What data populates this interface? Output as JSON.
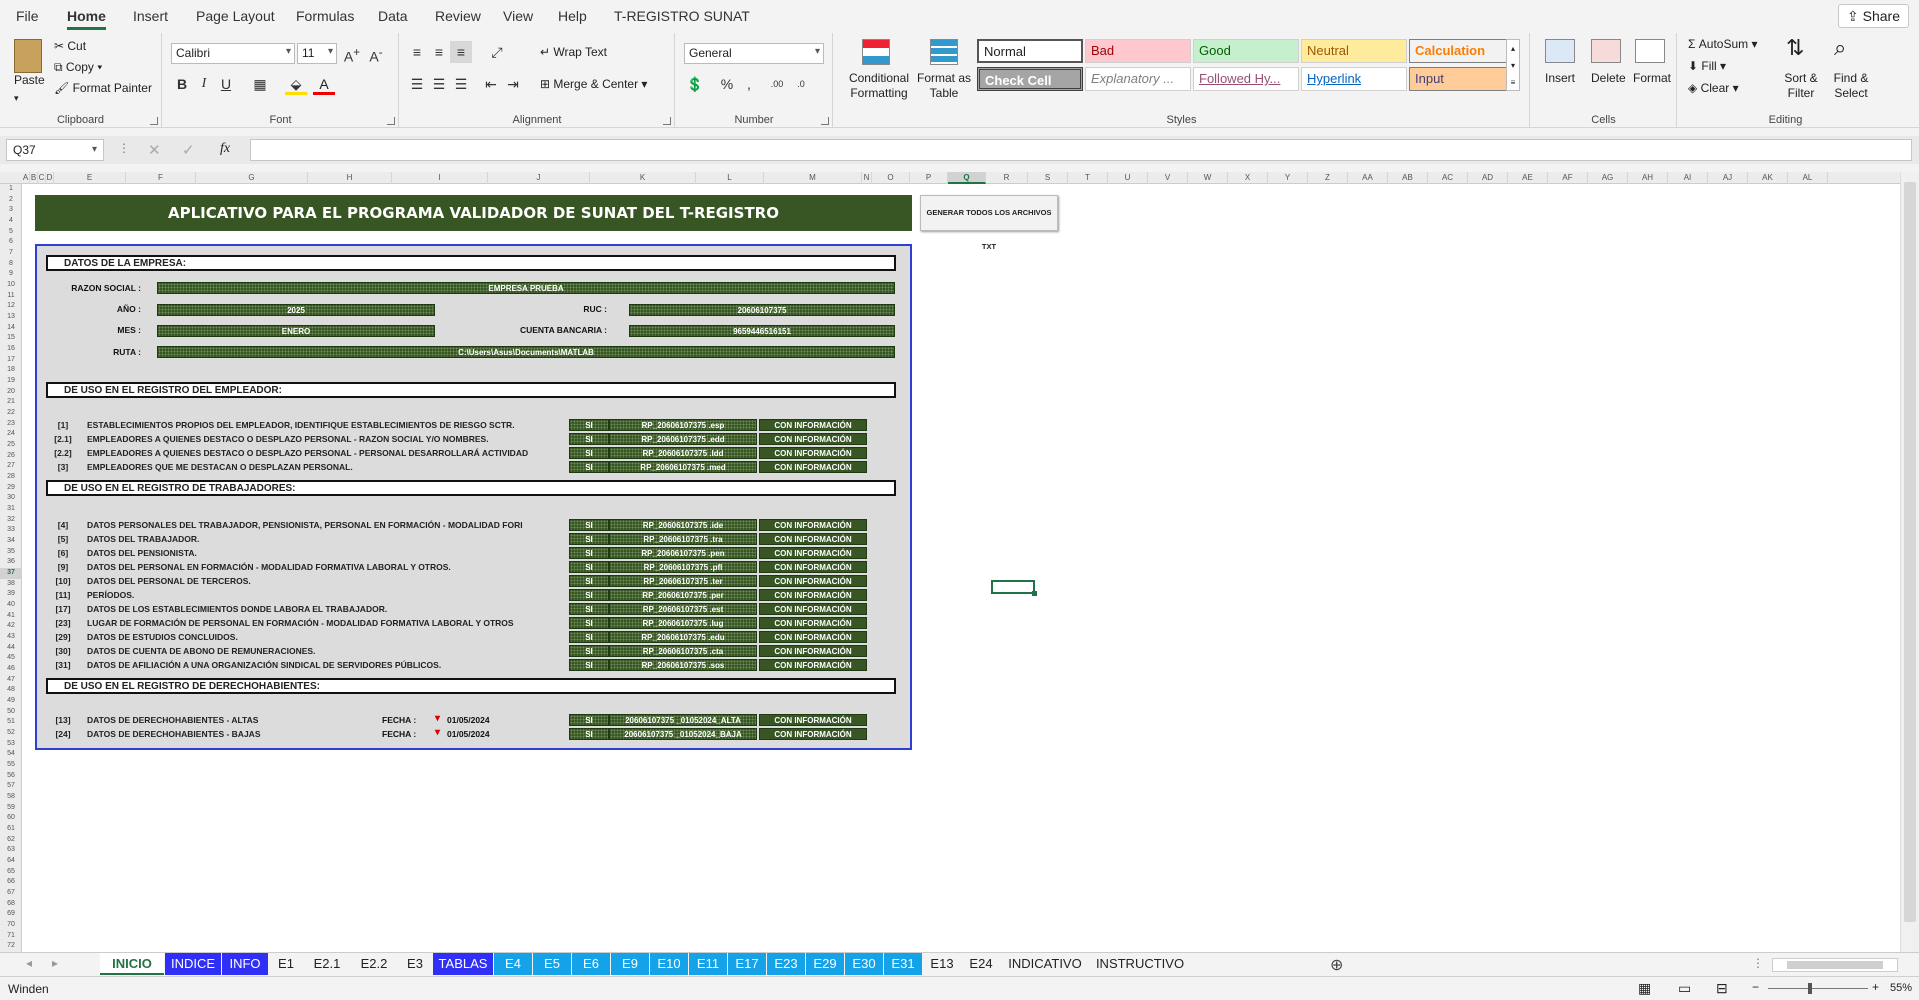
{
  "ribbon_tabs": [
    "File",
    "Home",
    "Insert",
    "Page Layout",
    "Formulas",
    "Data",
    "Review",
    "View",
    "Help",
    "T-REGISTRO SUNAT"
  ],
  "share_label": "Share",
  "clipboard": {
    "paste": "Paste",
    "cut": "Cut",
    "copy": "Copy",
    "format_painter": "Format Painter",
    "label": "Clipboard"
  },
  "font": {
    "name": "Calibri",
    "size": "11",
    "label": "Font"
  },
  "alignment": {
    "wrap": "Wrap Text",
    "merge": "Merge & Center",
    "label": "Alignment"
  },
  "number": {
    "format": "General",
    "label": "Number"
  },
  "styles": {
    "conditional": "Conditional Formatting",
    "format_table": "Format as Table",
    "cells": [
      "Normal",
      "Bad",
      "Good",
      "Neutral",
      "Calculation",
      "Check Cell",
      "Explanatory ...",
      "Followed Hy...",
      "Hyperlink",
      "Input"
    ],
    "label": "Styles"
  },
  "cells_group": {
    "insert": "Insert",
    "delete": "Delete",
    "format": "Format",
    "label": "Cells"
  },
  "editing": {
    "autosum": "AutoSum",
    "fill": "Fill",
    "clear": "Clear",
    "sort": "Sort & Filter",
    "find": "Find & Select",
    "label": "Editing"
  },
  "namebox": "Q37",
  "columns": [
    "A",
    "B",
    "C",
    "D",
    "E",
    "F",
    "G",
    "H",
    "I",
    "J",
    "K",
    "L",
    "M",
    "N",
    "O",
    "P",
    "Q",
    "R",
    "S",
    "T",
    "U",
    "V",
    "W",
    "X",
    "Y",
    "Z",
    "AA",
    "AB",
    "AC",
    "AD",
    "AE",
    "AF",
    "AG",
    "AH",
    "AI",
    "AJ",
    "AK",
    "AL"
  ],
  "rows": [
    "1",
    "2",
    "3",
    "4",
    "5",
    "6",
    "7",
    "8",
    "9",
    "10",
    "11",
    "12",
    "13",
    "14",
    "15",
    "16",
    "17",
    "18",
    "19",
    "20",
    "21",
    "22",
    "23",
    "24",
    "25",
    "26",
    "27",
    "28",
    "29",
    "30",
    "31",
    "32",
    "33",
    "34",
    "35",
    "36",
    "37",
    "38",
    "39",
    "40",
    "41",
    "42",
    "43",
    "44",
    "45",
    "46",
    "47",
    "48",
    "49",
    "50",
    "51",
    "52",
    "53",
    "54",
    "55",
    "56",
    "57",
    "58",
    "59",
    "60",
    "61",
    "62",
    "63",
    "64",
    "65",
    "66",
    "67",
    "68",
    "69",
    "70",
    "71",
    "72"
  ],
  "app": {
    "title": "APLICATIVO PARA EL PROGRAMA VALIDADOR DE SUNAT DEL T-REGISTRO",
    "generate_btn": "GENERAR TODOS LOS ARCHIVOS TXT",
    "empresa_head": "DATOS DE LA EMPRESA:",
    "razon_label": "RAZON SOCIAL :",
    "razon": "EMPRESA PRUEBA",
    "anio_label": "AÑO :",
    "anio": "2025",
    "ruc_label": "RUC :",
    "ruc": "20606107375",
    "mes_label": "MES :",
    "mes": "ENERO",
    "cuenta_label": "CUENTA BANCARIA :",
    "cuenta": "9659446516151",
    "ruta_label": "RUTA :",
    "ruta": "C:\\Users\\Asus\\Documents\\MATLAB",
    "empleador_head": "DE USO EN EL REGISTRO DEL EMPLEADOR:",
    "empleador_rows": [
      {
        "num": "[1]",
        "desc": "ESTABLECIMIENTOS PROPIOS DEL EMPLEADOR, IDENTIFIQUE ESTABLECIMIENTOS DE RIESGO SCTR.",
        "si": "SI",
        "file": "RP_20606107375 .esp",
        "info": "CON INFORMACIÓN"
      },
      {
        "num": "[2.1]",
        "desc": "EMPLEADORES A QUIENES DESTACO O DESPLAZO PERSONAL - RAZON SOCIAL Y/O NOMBRES.",
        "si": "SI",
        "file": "RP_20606107375 .edd",
        "info": "CON INFORMACIÓN"
      },
      {
        "num": "[2.2]",
        "desc": "EMPLEADORES A QUIENES DESTACO O DESPLAZO PERSONAL - PERSONAL DESARROLLARÁ ACTIVIDAD",
        "si": "SI",
        "file": "RP_20606107375 .ldd",
        "info": "CON INFORMACIÓN"
      },
      {
        "num": "[3]",
        "desc": "EMPLEADORES QUE ME DESTACAN O DESPLAZAN PERSONAL.",
        "si": "SI",
        "file": "RP_20606107375 .med",
        "info": "CON INFORMACIÓN"
      }
    ],
    "trabajadores_head": "DE USO EN EL REGISTRO DE TRABAJADORES:",
    "trabajadores_rows": [
      {
        "num": "[4]",
        "desc": "DATOS PERSONALES DEL TRABAJADOR, PENSIONISTA, PERSONAL EN FORMACIÓN - MODALIDAD FORI",
        "si": "SI",
        "file": "RP_20606107375 .ide",
        "info": "CON INFORMACIÓN"
      },
      {
        "num": "[5]",
        "desc": "DATOS DEL TRABAJADOR.",
        "si": "SI",
        "file": "RP_20606107375 .tra",
        "info": "CON INFORMACIÓN"
      },
      {
        "num": "[6]",
        "desc": "DATOS DEL PENSIONISTA.",
        "si": "SI",
        "file": "RP_20606107375 .pen",
        "info": "CON INFORMACIÓN"
      },
      {
        "num": "[9]",
        "desc": "DATOS DEL PERSONAL EN FORMACIÓN - MODALIDAD FORMATIVA LABORAL Y OTROS.",
        "si": "SI",
        "file": "RP_20606107375 .pfl",
        "info": "CON INFORMACIÓN"
      },
      {
        "num": "[10]",
        "desc": "DATOS DEL PERSONAL DE TERCEROS.",
        "si": "SI",
        "file": "RP_20606107375 .ter",
        "info": "CON INFORMACIÓN"
      },
      {
        "num": "[11]",
        "desc": "PERÍODOS.",
        "si": "SI",
        "file": "RP_20606107375 .per",
        "info": "CON INFORMACIÓN"
      },
      {
        "num": "[17]",
        "desc": "DATOS DE LOS ESTABLECIMIENTOS DONDE LABORA EL TRABAJADOR.",
        "si": "SI",
        "file": "RP_20606107375 .est",
        "info": "CON INFORMACIÓN"
      },
      {
        "num": "[23]",
        "desc": "LUGAR DE FORMACIÓN DE PERSONAL EN FORMACIÓN - MODALIDAD FORMATIVA LABORAL Y OTROS",
        "si": "SI",
        "file": "RP_20606107375 .lug",
        "info": "CON INFORMACIÓN"
      },
      {
        "num": "[29]",
        "desc": "DATOS DE ESTUDIOS CONCLUIDOS.",
        "si": "SI",
        "file": "RP_20606107375 .edu",
        "info": "CON INFORMACIÓN"
      },
      {
        "num": "[30]",
        "desc": "DATOS DE CUENTA DE ABONO DE REMUNERACIONES.",
        "si": "SI",
        "file": "RP_20606107375 .cta",
        "info": "CON INFORMACIÓN"
      },
      {
        "num": "[31]",
        "desc": "DATOS DE AFILIACIÓN A UNA ORGANIZACIÓN SINDICAL DE SERVIDORES PÚBLICOS.",
        "si": "SI",
        "file": "RP_20606107375 .sos",
        "info": "CON INFORMACIÓN"
      }
    ],
    "derecho_head": "DE USO EN EL REGISTRO DE DERECHOHABIENTES:",
    "derecho_rows": [
      {
        "num": "[13]",
        "desc": "DATOS DE DERECHOHABIENTES - ALTAS",
        "fecha_label": "FECHA :",
        "fecha": "01/05/2024",
        "si": "SI",
        "file": "20606107375 _01052024_ALTA",
        "info": "CON INFORMACIÓN"
      },
      {
        "num": "[24]",
        "desc": "DATOS DE DERECHOHABIENTES - BAJAS",
        "fecha_label": "FECHA :",
        "fecha": "01/05/2024",
        "si": "SI",
        "file": "20606107375 _01052024_BAJA",
        "info": "CON INFORMACIÓN"
      }
    ]
  },
  "sheet_tabs": [
    {
      "label": "INICIO",
      "kind": "active"
    },
    {
      "label": "INDICE",
      "kind": "blue"
    },
    {
      "label": "INFO",
      "kind": "blue"
    },
    {
      "label": "E1",
      "kind": "plain"
    },
    {
      "label": "E2.1",
      "kind": "plain"
    },
    {
      "label": "E2.2",
      "kind": "plain"
    },
    {
      "label": "E3",
      "kind": "plain"
    },
    {
      "label": "TABLAS",
      "kind": "blue"
    },
    {
      "label": "E4",
      "kind": "cyan"
    },
    {
      "label": "E5",
      "kind": "cyan"
    },
    {
      "label": "E6",
      "kind": "cyan"
    },
    {
      "label": "E9",
      "kind": "cyan"
    },
    {
      "label": "E10",
      "kind": "cyan"
    },
    {
      "label": "E11",
      "kind": "cyan"
    },
    {
      "label": "E17",
      "kind": "cyan"
    },
    {
      "label": "E23",
      "kind": "cyan"
    },
    {
      "label": "E29",
      "kind": "cyan"
    },
    {
      "label": "E30",
      "kind": "cyan"
    },
    {
      "label": "E31",
      "kind": "cyan"
    },
    {
      "label": "E13",
      "kind": "plain"
    },
    {
      "label": "E24",
      "kind": "plain"
    },
    {
      "label": "INDICATIVO",
      "kind": "plain"
    },
    {
      "label": "INSTRUCTIVO",
      "kind": "plain"
    }
  ],
  "status": {
    "mode": "Winden",
    "zoom": "55%"
  }
}
